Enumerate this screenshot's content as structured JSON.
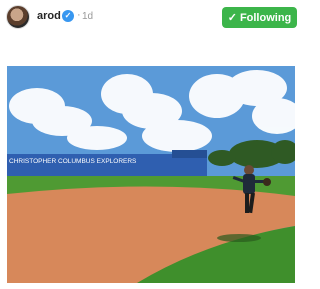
{
  "post": {
    "username": "arod",
    "verified_icon": "check-badge-icon",
    "separator": "·",
    "age": "1d",
    "follow_button": {
      "label": "Following",
      "icon": "check-icon",
      "color": "#3cb54a"
    }
  },
  "photo": {
    "wall_text": "CHRISTOPHER COLUMBUS EXPLORERS",
    "colors": {
      "sky": "#5b9ad8",
      "wall": "#2f5fb0",
      "infield": "#d7885a",
      "grass": "#3f8f2c"
    }
  }
}
